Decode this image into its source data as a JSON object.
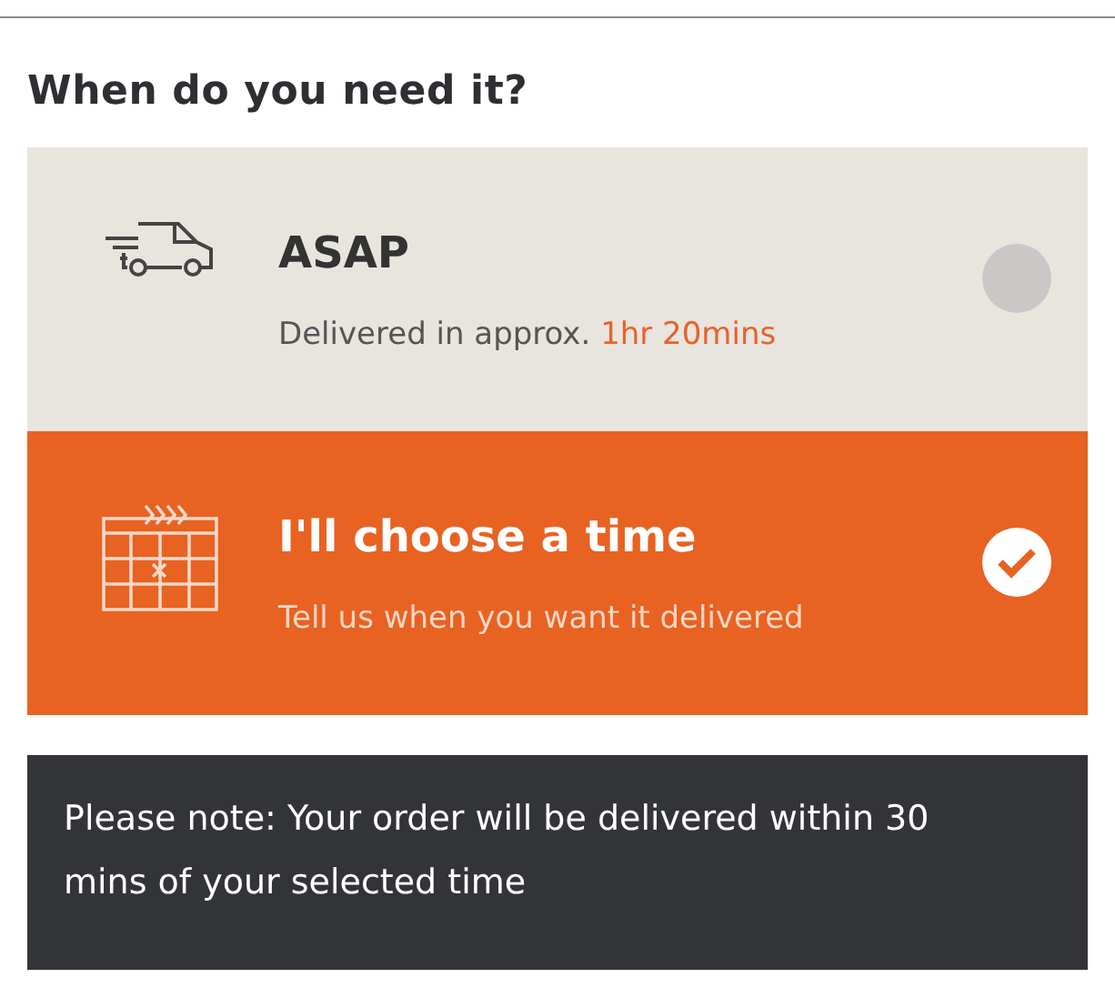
{
  "heading": "When do you need it?",
  "options": [
    {
      "kind": "asap",
      "title": "ASAP",
      "subtitle": "Delivered in approx.",
      "highlight": "1hr 20mins",
      "selected": false
    },
    {
      "kind": "scheduled",
      "title": "I'll choose a time",
      "subtitle": "Tell us when you want it delivered",
      "selected": true
    }
  ],
  "note": "Please note: Your order will be delivered within 30 mins of your selected time"
}
